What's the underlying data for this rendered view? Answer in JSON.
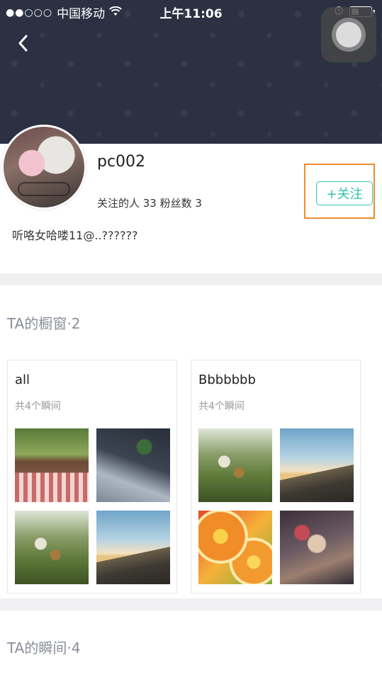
{
  "status_bar": {
    "signal": "●●○○○",
    "carrier": "中国移动",
    "wifi_icon": "wifi-icon",
    "time": "上午11:06",
    "alarm_icon": "alarm-icon",
    "battery_icon": "battery-icon"
  },
  "header": {
    "back_icon": "chevron-left-icon"
  },
  "profile": {
    "username": "pc002",
    "stats": "关注的人 33 粉丝数 3",
    "follow_label": "+关注",
    "bio": "听咯女哈喽11@..??????"
  },
  "showcase": {
    "title": "TA的橱窗·2",
    "albums": [
      {
        "name": "all",
        "count": "共4个瞬间"
      },
      {
        "name": "Bbbbbbb",
        "count": "共4个瞬间"
      }
    ]
  },
  "moments": {
    "title": "TA的瞬间·4"
  },
  "colors": {
    "banner": "#2b3142",
    "accent": "#33c1b0",
    "highlight": "#f08a2c"
  }
}
